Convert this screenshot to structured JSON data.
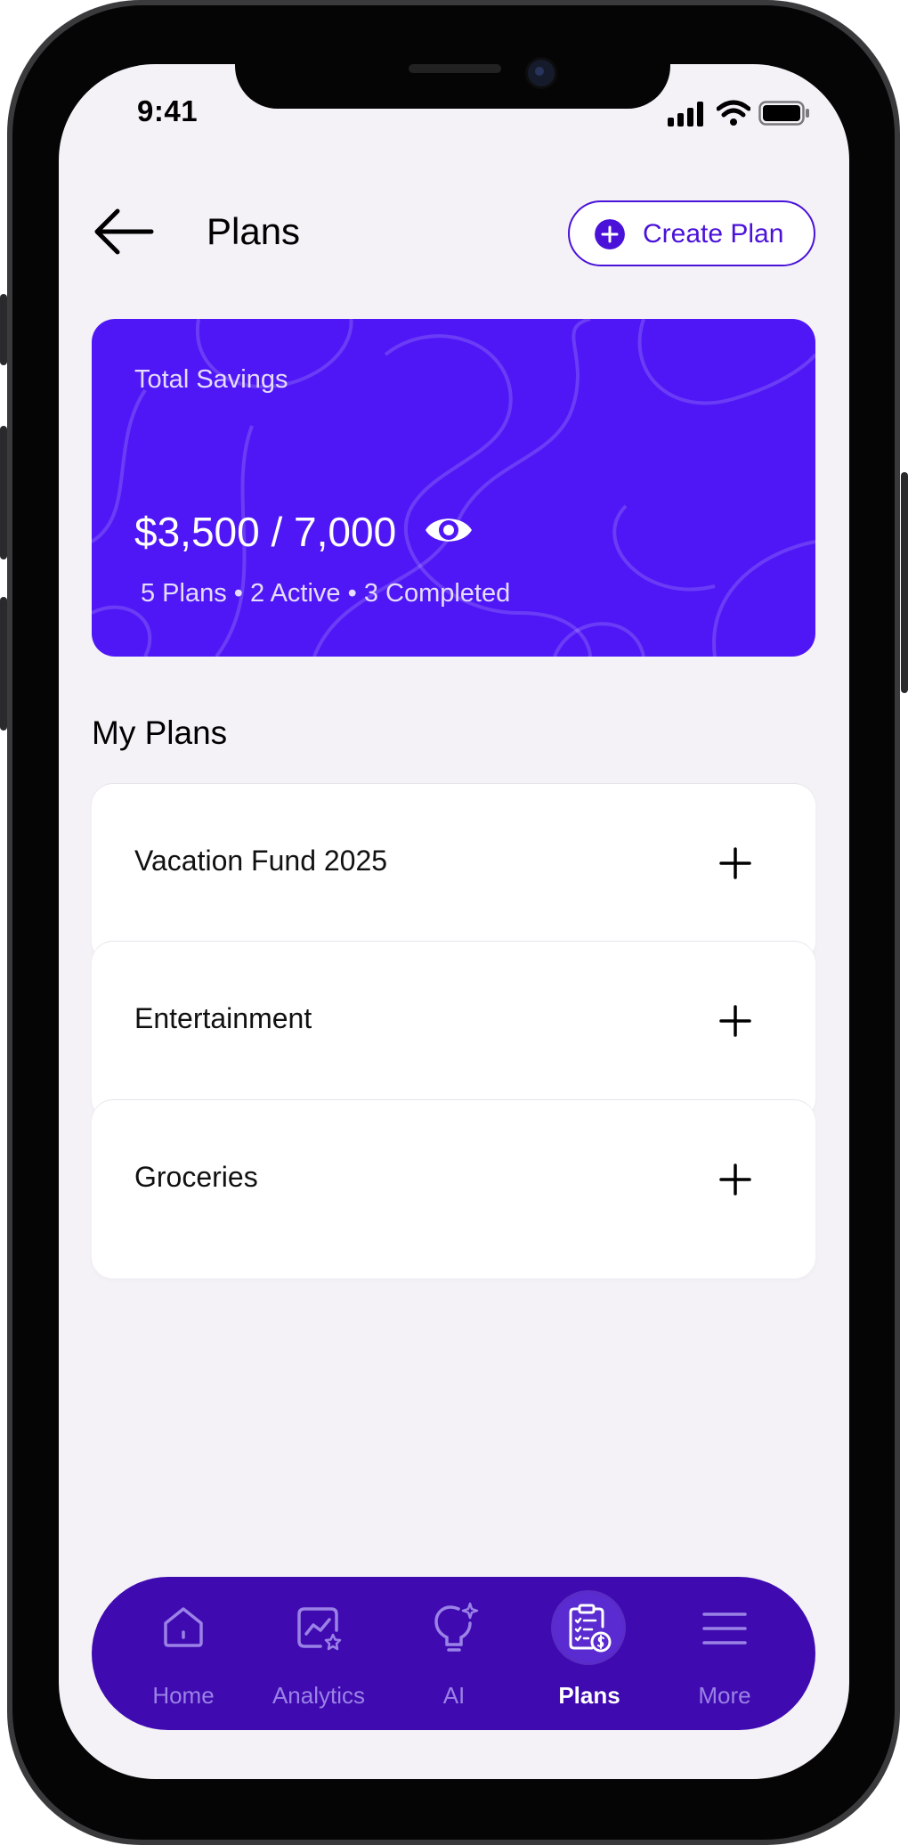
{
  "status_bar": {
    "time": "9:41"
  },
  "header": {
    "title": "Plans",
    "create_label": "Create Plan"
  },
  "savings": {
    "label": "Total Savings",
    "amount": "$3,500 / 7,000",
    "meta": "5 Plans • 2 Active • 3 Completed"
  },
  "section": {
    "title": "My Plans"
  },
  "plans": [
    {
      "name": "Vacation Fund 2025"
    },
    {
      "name": "Entertainment"
    },
    {
      "name": "Groceries"
    }
  ],
  "nav": {
    "items": [
      {
        "label": "Home",
        "icon": "home-icon"
      },
      {
        "label": "Analytics",
        "icon": "analytics-icon"
      },
      {
        "label": "AI",
        "icon": "lightbulb-sparkle-icon"
      },
      {
        "label": "Plans",
        "icon": "clipboard-dollar-icon",
        "active": true
      },
      {
        "label": "More",
        "icon": "menu-icon"
      }
    ]
  },
  "colors": {
    "accent": "#4a12d8",
    "card": "#4f17f5",
    "nav": "#3f0ab0",
    "background": "#f4f2f7"
  }
}
